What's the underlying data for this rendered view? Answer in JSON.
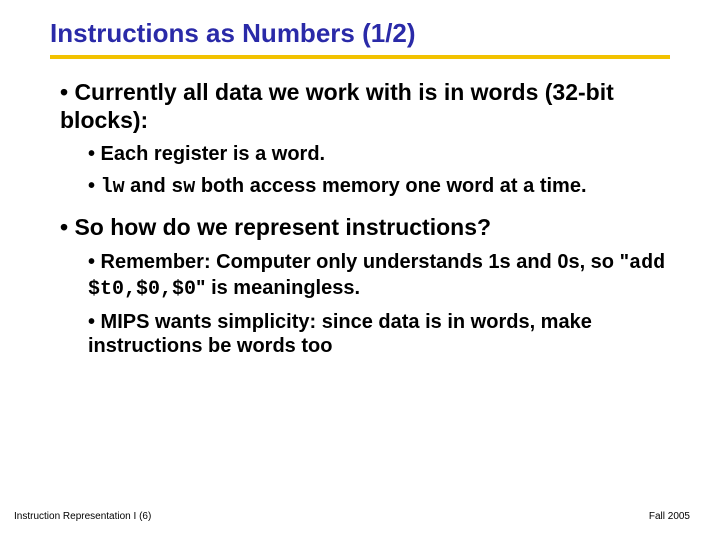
{
  "title": "Instructions as Numbers (1/2)",
  "bullets": {
    "p1": "• Currently all data we work with is in words (32-bit blocks):",
    "p1a": "• Each register is a word.",
    "p1b_pre": "• ",
    "p1b_lw": "lw",
    "p1b_mid": " and ",
    "p1b_sw": "sw",
    "p1b_post": " both access memory one word at a time.",
    "p2": "• So how do we represent instructions?",
    "p2a_pre": "• Remember: Computer only understands 1s and 0s, so \"",
    "p2a_code": "add $t0,$0,$0",
    "p2a_post": "\" is meaningless.",
    "p2b": "• MIPS wants simplicity: since data is in words, make instructions be words too"
  },
  "footer": {
    "left": "Instruction Representation I (6)",
    "right": "Fall 2005"
  }
}
